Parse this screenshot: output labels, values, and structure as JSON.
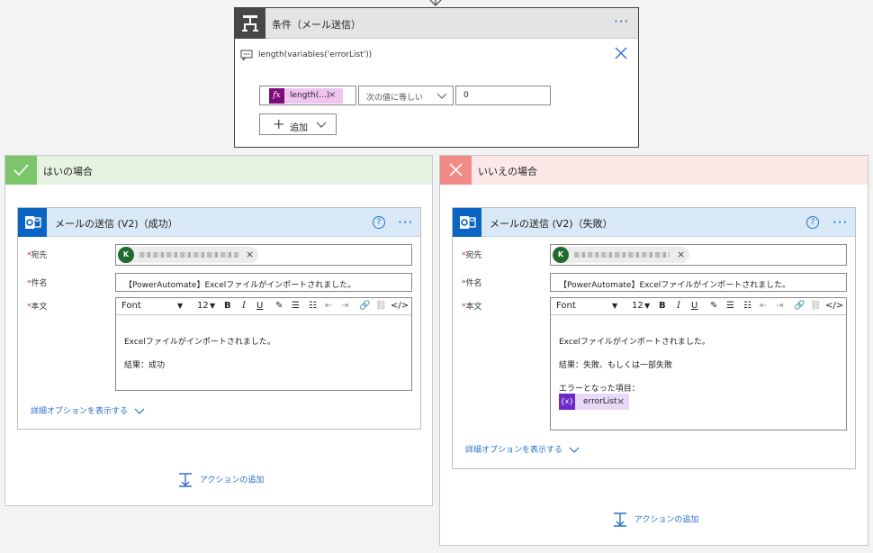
{
  "condition": {
    "title": "条件（メール送信）",
    "expression": "length(variables('errorList'))",
    "left_operand": "length(...)",
    "operator": "次の値に等しい",
    "right_operand": "0",
    "add_label": "追加"
  },
  "yes_branch": {
    "title": "はいの場合",
    "header_color": "#e6f3e1",
    "icon_color": "#7cc76b",
    "email": {
      "title": "メールの送信 (V2)（成功）",
      "to_label": "宛先",
      "avatar_letter": "K",
      "subject_label": "件名",
      "subject": "【PowerAutomate】Excelファイルがインポートされました。",
      "body_label": "本文",
      "font": "Font",
      "font_size": "12",
      "body_line1": "Excelファイルがインポートされました。",
      "body_line2": "結果：成功",
      "advanced": "詳細オプションを表示する"
    },
    "add_action": "アクションの追加"
  },
  "no_branch": {
    "title": "いいえの場合",
    "header_color": "#fde7e7",
    "icon_color": "#f28b88",
    "email": {
      "title": "メールの送信 (V2)（失敗）",
      "to_label": "宛先",
      "avatar_letter": "K",
      "subject_label": "件名",
      "subject": "【PowerAutomate】Excelファイルがインポートされました。",
      "body_label": "本文",
      "font": "Font",
      "font_size": "12",
      "body_line1": "Excelファイルがインポートされました。",
      "body_line2": "結果：失敗、もしくは一部失敗",
      "body_line3": "エラーとなった項目：",
      "variable": "errorList",
      "variable_icon": "{x}",
      "advanced": "詳細オプションを表示する"
    },
    "add_action": "アクションの追加"
  },
  "colors": {
    "accent": "#0a64c4",
    "link": "#2b70c9",
    "required": "#c4314b",
    "expression_chip": "#f0c4f0",
    "variable_chip": "#e9d9f7"
  }
}
